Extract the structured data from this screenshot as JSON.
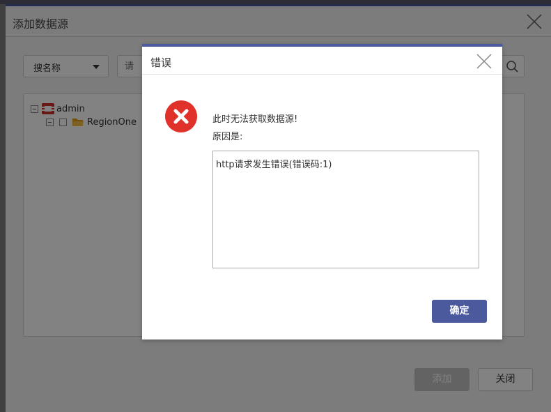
{
  "outer_dialog": {
    "title": "添加数据源",
    "search_type": "搜名称",
    "search_placeholder": "请",
    "tree": {
      "root_label": "admin",
      "child_label": "RegionOne"
    },
    "add_button": "添加",
    "close_button": "关闭"
  },
  "error_dialog": {
    "title": "错误",
    "message_line1": "此时无法获取数据源!",
    "message_line2": "原因是:",
    "detail": "http请求发生错误(错误码:1)",
    "ok_button": "确定"
  },
  "colors": {
    "accent": "#4a5a9c",
    "error_red": "#e0312b",
    "folder_yellow": "#e3a21a",
    "openstack_red": "#d0302c"
  }
}
